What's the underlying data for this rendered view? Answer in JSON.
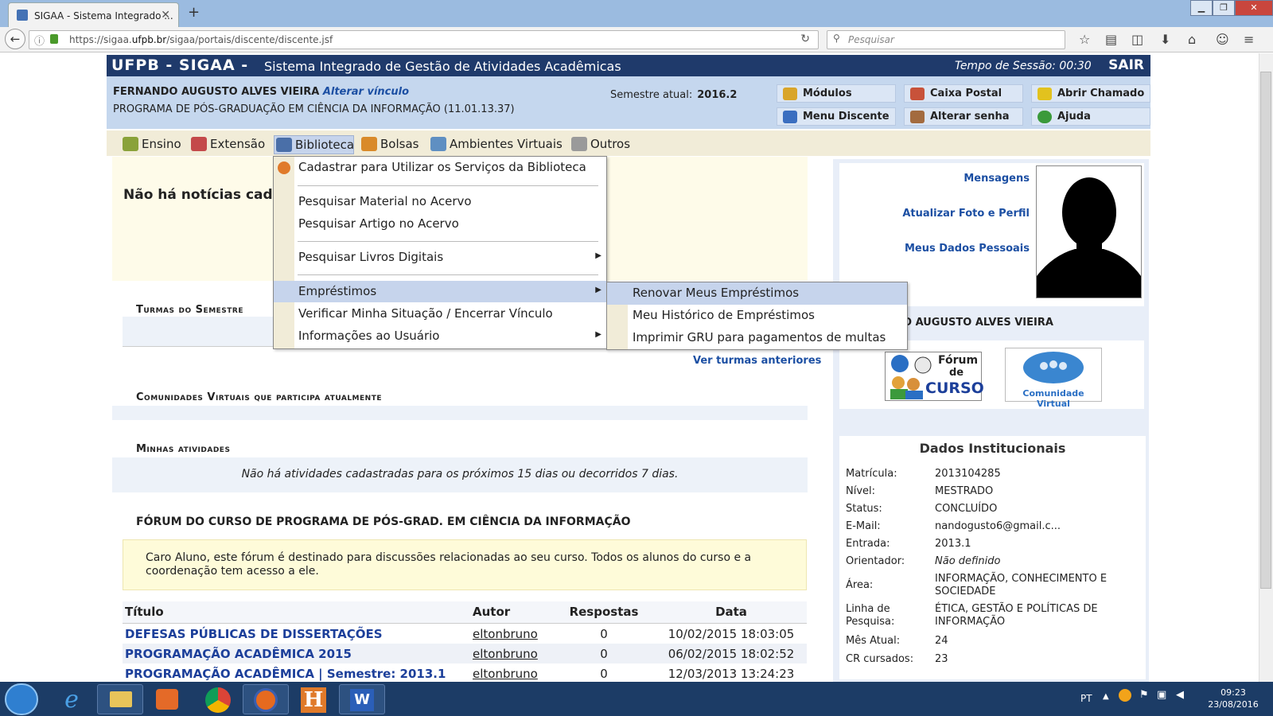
{
  "browser": {
    "tab_title": "SIGAA - Sistema Integrado ...",
    "url_prefix": "https://sigaa.",
    "url_host": "ufpb.br",
    "url_path": "/sigaa/portais/discente/discente.jsf",
    "search_placeholder": "Pesquisar"
  },
  "header": {
    "brand": "UFPB - SIGAA -",
    "subtitle": "Sistema Integrado de Gestão de Atividades Acadêmicas",
    "session_label": "Tempo de Sessão: 00:30",
    "logout": "SAIR"
  },
  "user": {
    "name": "FERNANDO AUGUSTO ALVES VIEIRA",
    "change_link": "Alterar vínculo",
    "program": "PROGRAMA DE PÓS-GRADUAÇÃO EM CIÊNCIA DA INFORMAÇÃO (11.01.13.37)",
    "semester_label": "Semestre atual:",
    "semester_value": "2016.2"
  },
  "quick": {
    "modulos": "Módulos",
    "caixa": "Caixa Postal",
    "chamado": "Abrir Chamado",
    "menu_discente": "Menu Discente",
    "senha": "Alterar senha",
    "ajuda": "Ajuda"
  },
  "menu": {
    "ensino": "Ensino",
    "extensao": "Extensão",
    "biblioteca": "Biblioteca",
    "bolsas": "Bolsas",
    "ambientes": "Ambientes Virtuais",
    "outros": "Outros"
  },
  "biblio_menu": {
    "cadastrar": "Cadastrar para Utilizar os Serviços da Biblioteca",
    "pesq_material": "Pesquisar Material no Acervo",
    "pesq_artigo": "Pesquisar Artigo no Acervo",
    "pesq_livros": "Pesquisar Livros Digitais",
    "emprestimos": "Empréstimos",
    "verificar": "Verificar Minha Situação / Encerrar Vínculo",
    "info": "Informações ao Usuário"
  },
  "emprestimos_menu": {
    "renovar": "Renovar Meus Empréstimos",
    "historico": "Meu Histórico de Empréstimos",
    "gru": "Imprimir GRU para pagamentos de multas"
  },
  "main": {
    "news": "Não há notícias cadastradas",
    "turmas_title": "Turmas do Semestre",
    "ver_turmas": "Ver turmas anteriores",
    "comunidades_title": "Comunidades Virtuais que participa atualmente",
    "atividades_title": "Minhas atividades",
    "atividades_empty": "Não há atividades cadastradas para os próximos 15 dias ou decorridos 7 dias.",
    "forum_title": "FÓRUM DO CURSO DE PROGRAMA DE PÓS-GRAD. EM CIÊNCIA DA INFORMAÇÃO",
    "forum_note": "Caro Aluno, este fórum é destinado para discussões relacionadas ao seu curso. Todos os alunos do curso e a coordenação tem acesso a ele.",
    "forum_cols": [
      "Título",
      "Autor",
      "Respostas",
      "Data"
    ],
    "forum_rows": [
      {
        "titulo": "DEFESAS PÚBLICAS DE DISSERTAÇÕES",
        "autor": "eltonbruno",
        "respostas": "0",
        "data": "10/02/2015 18:03:05"
      },
      {
        "titulo": "PROGRAMAÇÃO ACADÊMICA 2015",
        "autor": "eltonbruno",
        "respostas": "0",
        "data": "06/02/2015 18:02:52"
      },
      {
        "titulo": "PROGRAMAÇÃO ACADÊMICA | Semestre: 2013.1",
        "autor": "eltonbruno",
        "respostas": "0",
        "data": "12/03/2013 13:24:23"
      }
    ]
  },
  "sidebar": {
    "mensagens": "Mensagens",
    "atualizar": "Atualizar Foto e Perfil",
    "dados_pessoais": "Meus Dados Pessoais",
    "name_partial": "O AUGUSTO ALVES VIEIRA",
    "forum_icon_line1": "Fórum",
    "forum_icon_line2": "de",
    "forum_icon_line3": "CURSO",
    "comunidade_icon": "Comunidade Virtual",
    "dados_title": "Dados Institucionais",
    "dados": [
      {
        "label": "Matrícula:",
        "value": "2013104285"
      },
      {
        "label": "Nível:",
        "value": "MESTRADO"
      },
      {
        "label": "Status:",
        "value": "CONCLUÍDO"
      },
      {
        "label": "E-Mail:",
        "value": "nandogusto6@gmail.c..."
      },
      {
        "label": "Entrada:",
        "value": "2013.1"
      },
      {
        "label": "Orientador:",
        "value": "Não definido"
      },
      {
        "label": "Área:",
        "value": "INFORMAÇÃO, CONHECIMENTO E SOCIEDADE"
      },
      {
        "label": "Linha de Pesquisa:",
        "value": "ÉTICA, GESTÃO E POLÍTICAS DE INFORMAÇÃO"
      },
      {
        "label": "Mês Atual:",
        "value": "24"
      },
      {
        "label": "CR cursados:",
        "value": "23"
      }
    ]
  },
  "taskbar": {
    "lang": "PT",
    "time": "09:23",
    "date": "23/08/2016"
  }
}
